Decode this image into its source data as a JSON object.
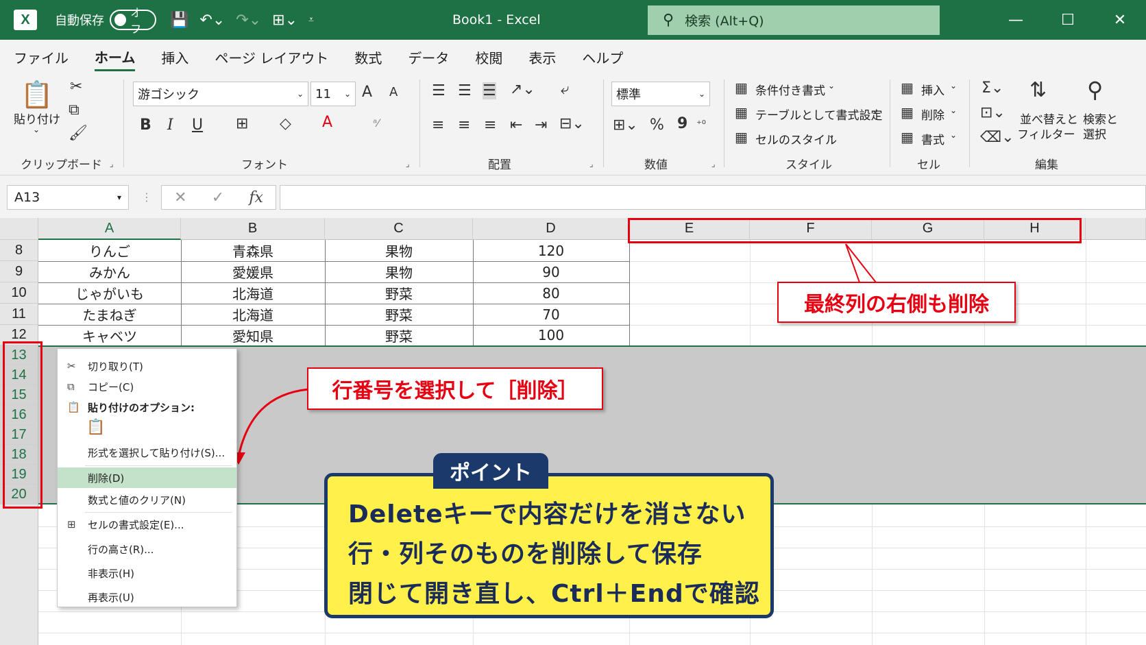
{
  "titlebar": {
    "logo": "X",
    "autosave_label": "自動保存",
    "autosave_state": "オフ",
    "doc_title": "Book1  -  Excel",
    "search_placeholder": "検索 (Alt+Q)"
  },
  "tabs": [
    "ファイル",
    "ホーム",
    "挿入",
    "ページ レイアウト",
    "数式",
    "データ",
    "校閲",
    "表示",
    "ヘルプ"
  ],
  "ribbon": {
    "clipboard": {
      "paste_label": "貼り付け",
      "group": "クリップボード"
    },
    "font": {
      "family": "游ゴシック",
      "size": "11",
      "grow": "A",
      "shrink": "A",
      "bold": "B",
      "italic": "I",
      "underline": "U",
      "group": "フォント"
    },
    "alignment": {
      "group": "配置"
    },
    "number": {
      "format": "標準",
      "percent": "%",
      "comma": "9",
      "group": "数値"
    },
    "styles": {
      "conditional": "条件付き書式",
      "as_table": "テーブルとして書式設定",
      "cell_styles": "セルのスタイル",
      "group": "スタイル"
    },
    "cells": {
      "insert": "挿入",
      "delete": "削除",
      "format": "書式",
      "group": "セル"
    },
    "editing": {
      "sort_filter_1": "並べ替えと",
      "sort_filter_2": "フィルター",
      "find_1": "検索と",
      "find_2": "選択",
      "group": "編集"
    }
  },
  "formula_bar": {
    "name_box": "A13",
    "fx": "fx",
    "cancel": "✕",
    "enter": "✓"
  },
  "columns": [
    "A",
    "B",
    "C",
    "D",
    "E",
    "F",
    "G",
    "H"
  ],
  "rows": [
    "8",
    "9",
    "10",
    "11",
    "12",
    "13",
    "14",
    "15",
    "16",
    "17",
    "18",
    "19",
    "20"
  ],
  "table": [
    [
      "りんご",
      "青森県",
      "果物",
      "120"
    ],
    [
      "みかん",
      "愛媛県",
      "果物",
      "90"
    ],
    [
      "じゃがいも",
      "北海道",
      "野菜",
      "80"
    ],
    [
      "たまねぎ",
      "北海道",
      "野菜",
      "70"
    ],
    [
      "キャベツ",
      "愛知県",
      "野菜",
      "100"
    ]
  ],
  "context_menu": {
    "cut": "切り取り(T)",
    "copy": "コピー(C)",
    "paste_options": "貼り付けのオプション:",
    "paste_special": "形式を選択して貼り付け(S)...",
    "delete": "削除(D)",
    "clear": "数式と値のクリア(N)",
    "format_cells": "セルの書式設定(E)...",
    "row_height": "行の高さ(R)...",
    "hide": "非表示(H)",
    "unhide": "再表示(U)"
  },
  "callouts": {
    "right_of_last_col": "最終列の右側も削除",
    "select_row": "行番号を選択して［削除］"
  },
  "point": {
    "tag": "ポイント",
    "line1": "Deleteキーで内容だけを消さない",
    "line2": "行・列そのものを削除して保存",
    "line3": "閉じて開き直し、Ctrl＋Endで確認"
  },
  "colors": {
    "excel_green": "#1e7145",
    "callout_red": "#e60012",
    "point_yellow": "#fff04a",
    "point_navy": "#1b3a6b"
  }
}
